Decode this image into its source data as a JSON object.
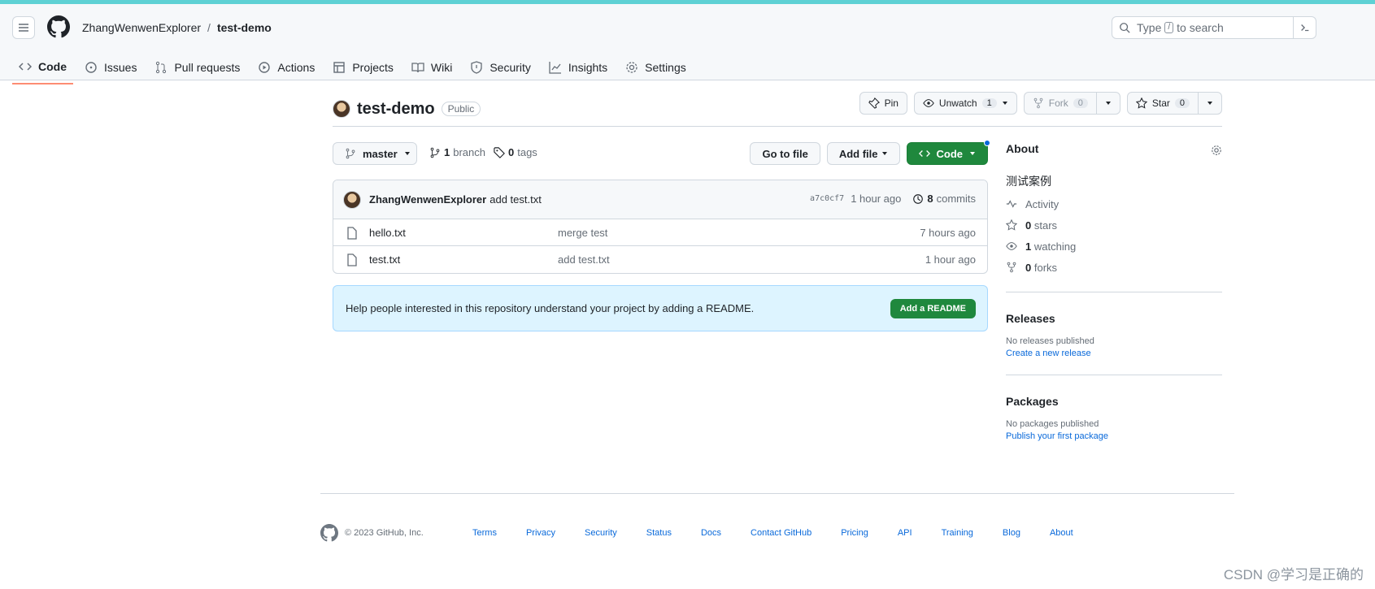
{
  "header": {
    "owner": "ZhangWenwenExplorer",
    "separator": "/",
    "repo": "test-demo",
    "search_prefix": "Type",
    "search_key": "/",
    "search_suffix": "to search"
  },
  "tabs": [
    {
      "label": "Code",
      "icon": "code-icon"
    },
    {
      "label": "Issues",
      "icon": "issue-icon"
    },
    {
      "label": "Pull requests",
      "icon": "pull-request-icon"
    },
    {
      "label": "Actions",
      "icon": "play-icon"
    },
    {
      "label": "Projects",
      "icon": "table-icon"
    },
    {
      "label": "Wiki",
      "icon": "book-icon"
    },
    {
      "label": "Security",
      "icon": "shield-icon"
    },
    {
      "label": "Insights",
      "icon": "graph-icon"
    },
    {
      "label": "Settings",
      "icon": "gear-icon"
    }
  ],
  "repo": {
    "name": "test-demo",
    "visibility": "Public",
    "pin": "Pin",
    "unwatch": "Unwatch",
    "watch_count": "1",
    "fork": "Fork",
    "fork_count": "0",
    "star": "Star",
    "star_count": "0"
  },
  "toolbar": {
    "branch": "master",
    "branch_count": "1",
    "branch_label": "branch",
    "tag_count": "0",
    "tag_label": "tags",
    "go_to_file": "Go to file",
    "add_file": "Add file",
    "code": "Code"
  },
  "commit": {
    "author": "ZhangWenwenExplorer",
    "message": "add test.txt",
    "sha": "a7c0cf7",
    "time": "1 hour ago",
    "count": "8",
    "count_label": "commits"
  },
  "files": [
    {
      "name": "hello.txt",
      "message": "merge test",
      "time": "7 hours ago"
    },
    {
      "name": "test.txt",
      "message": "add test.txt",
      "time": "1 hour ago"
    }
  ],
  "readme": {
    "text": "Help people interested in this repository understand your project by adding a README.",
    "button": "Add a README"
  },
  "about": {
    "title": "About",
    "description": "测试案例",
    "activity": "Activity",
    "stars_count": "0",
    "stars_label": "stars",
    "watching_count": "1",
    "watching_label": "watching",
    "forks_count": "0",
    "forks_label": "forks"
  },
  "releases": {
    "title": "Releases",
    "none": "No releases published",
    "link": "Create a new release"
  },
  "packages": {
    "title": "Packages",
    "none": "No packages published",
    "link": "Publish your first package"
  },
  "footer": {
    "copyright": "© 2023 GitHub, Inc.",
    "links": [
      "Terms",
      "Privacy",
      "Security",
      "Status",
      "Docs",
      "Contact GitHub",
      "Pricing",
      "API",
      "Training",
      "Blog",
      "About"
    ]
  },
  "watermark": "CSDN @学习是正确的",
  "colors": {
    "accent_green": "#1f883d",
    "link_blue": "#0969da",
    "tab_underline": "#fd8c73",
    "top_strip": "#5ed1d4"
  }
}
